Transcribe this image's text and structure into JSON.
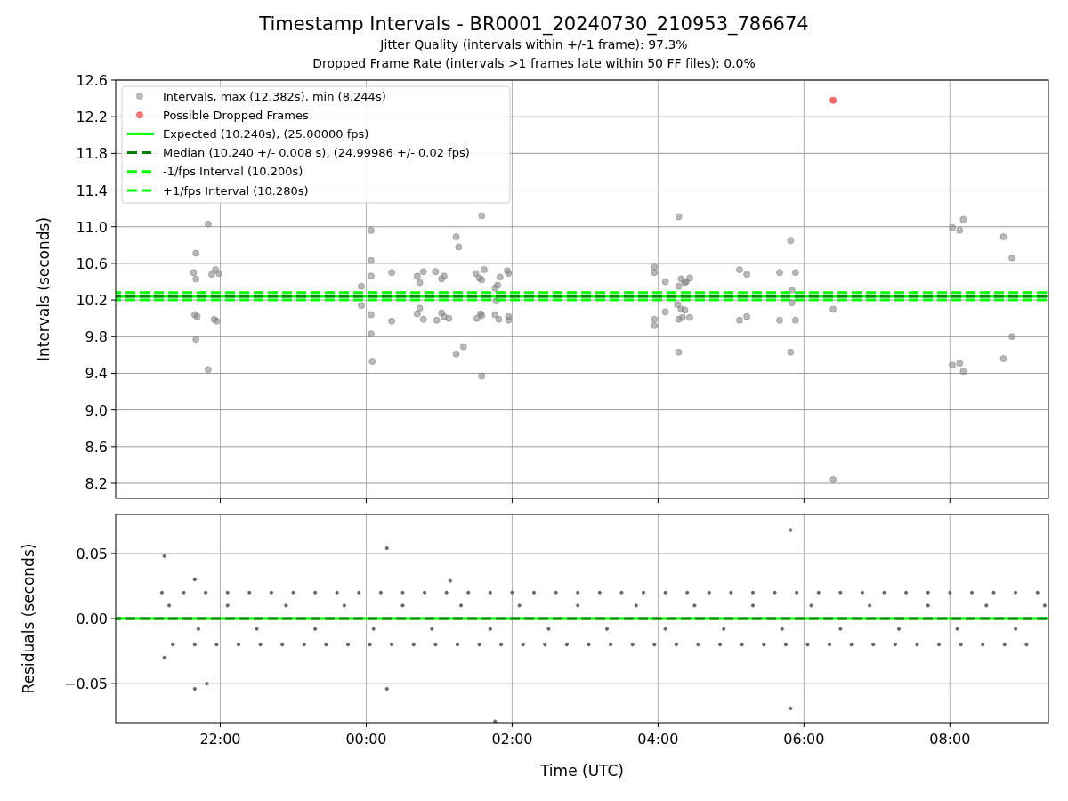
{
  "figure": {
    "title": "Timestamp Intervals - BR0001_20240730_210953_786674",
    "subtitles": [
      "Jitter Quality (intervals within +/-1 frame): 97.3%",
      "Dropped Frame Rate (intervals >1 frames late within 50 FF files): 0.0%"
    ]
  },
  "intervals_plot": {
    "chart_data": {
      "type": "scatter",
      "ylabel": "Intervals (seconds)",
      "xlim": [
        "2024-07-30T20:34",
        "2024-07-31T09:21"
      ],
      "ylim": [
        8.035,
        12.6
      ],
      "grid": true,
      "legend": true,
      "yticks": [
        {
          "value": 8.2,
          "label": "8.2"
        },
        {
          "value": 8.6,
          "label": "8.6"
        },
        {
          "value": 9.0,
          "label": "9.0"
        },
        {
          "value": 9.4,
          "label": "9.4"
        },
        {
          "value": 9.8,
          "label": "9.8"
        },
        {
          "value": 10.2,
          "label": "10.2"
        },
        {
          "value": 10.6,
          "label": "10.6"
        },
        {
          "value": 11.0,
          "label": "11.0"
        },
        {
          "value": 11.4,
          "label": "11.4"
        },
        {
          "value": 11.8,
          "label": "11.8"
        },
        {
          "value": 12.2,
          "label": "12.2"
        },
        {
          "value": 12.6,
          "label": "12.6"
        }
      ],
      "series": [
        {
          "name": "Intervals, max (12.382s), min (8.244s)",
          "color": "#808080",
          "x": [
            "2024-07-30T21:50",
            "2024-07-30T21:40",
            "2024-07-30T21:38",
            "2024-07-30T21:40",
            "2024-07-30T21:56",
            "2024-07-30T21:53",
            "2024-07-30T21:59",
            "2024-07-30T21:39",
            "2024-07-30T21:41",
            "2024-07-30T21:55",
            "2024-07-30T21:57",
            "2024-07-30T21:40",
            "2024-07-30T21:50",
            "2024-07-31T00:04",
            "2024-07-31T00:04",
            "2024-07-31T00:04",
            "2024-07-30T23:56",
            "2024-07-30T23:56",
            "2024-07-31T00:04",
            "2024-07-31T00:04",
            "2024-07-31T00:05",
            "2024-07-31T00:21",
            "2024-07-31T00:21",
            "2024-07-31T00:42",
            "2024-07-31T00:47",
            "2024-07-31T00:42",
            "2024-07-31T00:44",
            "2024-07-31T00:47",
            "2024-07-31T00:44",
            "2024-07-31T00:57",
            "2024-07-31T00:58",
            "2024-07-31T01:04",
            "2024-07-31T01:02",
            "2024-07-31T01:02",
            "2024-07-31T01:04",
            "2024-07-31T01:08",
            "2024-07-31T01:14",
            "2024-07-31T01:16",
            "2024-07-31T01:14",
            "2024-07-31T01:20",
            "2024-07-31T01:30",
            "2024-07-31T01:33",
            "2024-07-31T01:35",
            "2024-07-31T01:31",
            "2024-07-31T01:34",
            "2024-07-31T01:35",
            "2024-07-31T01:35",
            "2024-07-31T01:35",
            "2024-07-31T01:37",
            "2024-07-31T01:46",
            "2024-07-31T01:48",
            "2024-07-31T01:46",
            "2024-07-31T01:47",
            "2024-07-31T01:50",
            "2024-07-31T01:49",
            "2024-07-31T01:56",
            "2024-07-31T01:57",
            "2024-07-31T01:57",
            "2024-07-31T01:57",
            "2024-07-31T03:57",
            "2024-07-31T03:57",
            "2024-07-31T03:57",
            "2024-07-31T03:57",
            "2024-07-31T04:06",
            "2024-07-31T04:06",
            "2024-07-31T04:17",
            "2024-07-31T04:17",
            "2024-07-31T04:17",
            "2024-07-31T04:19",
            "2024-07-31T04:22",
            "2024-07-31T04:23",
            "2024-07-31T04:26",
            "2024-07-31T04:16",
            "2024-07-31T04:19",
            "2024-07-31T04:22",
            "2024-07-31T04:17",
            "2024-07-31T04:20",
            "2024-07-31T04:26",
            "2024-07-31T05:07",
            "2024-07-31T05:13",
            "2024-07-31T05:07",
            "2024-07-31T05:13",
            "2024-07-31T05:40",
            "2024-07-31T05:53",
            "2024-07-31T05:40",
            "2024-07-31T05:53",
            "2024-07-31T05:49",
            "2024-07-31T05:49",
            "2024-07-31T05:50",
            "2024-07-31T05:50",
            "2024-07-31T06:24",
            "2024-07-31T06:24",
            "2024-07-31T08:02",
            "2024-07-31T08:08",
            "2024-07-31T08:11",
            "2024-07-31T08:02",
            "2024-07-31T08:08",
            "2024-07-31T08:11",
            "2024-07-31T08:44",
            "2024-07-31T08:51",
            "2024-07-31T08:44",
            "2024-07-31T08:51"
          ],
          "values": [
            11.03,
            10.71,
            10.5,
            10.43,
            10.53,
            10.48,
            10.49,
            10.04,
            10.02,
            9.99,
            9.97,
            9.77,
            9.44,
            10.96,
            10.63,
            10.46,
            10.35,
            10.14,
            10.04,
            9.83,
            9.53,
            10.5,
            9.97,
            10.46,
            10.51,
            10.05,
            10.11,
            9.99,
            10.39,
            10.51,
            9.98,
            10.46,
            10.43,
            10.06,
            10.02,
            10.0,
            10.89,
            10.78,
            9.61,
            9.69,
            10.49,
            10.44,
            10.42,
            10.0,
            10.05,
            10.03,
            11.12,
            9.37,
            10.53,
            10.33,
            10.36,
            10.04,
            10.19,
            10.45,
            9.99,
            10.52,
            10.49,
            9.98,
            10.02,
            10.56,
            10.5,
            9.99,
            9.92,
            10.07,
            10.4,
            11.11,
            9.63,
            10.35,
            10.43,
            10.39,
            10.4,
            10.44,
            10.15,
            10.1,
            10.09,
            9.99,
            10.01,
            10.01,
            10.53,
            10.48,
            9.98,
            10.02,
            10.5,
            10.5,
            9.98,
            9.98,
            10.85,
            9.63,
            10.31,
            10.17,
            10.1,
            8.24,
            10.99,
            10.96,
            11.08,
            9.49,
            9.51,
            9.42,
            10.89,
            10.66,
            9.56,
            9.8
          ]
        },
        {
          "name": "Possible Dropped Frames",
          "color": "#ff0000",
          "x": [
            "2024-07-31T06:24"
          ],
          "values": [
            12.38
          ]
        }
      ],
      "ref_lines": [
        {
          "axis": "y",
          "value": 10.24,
          "label": "Expected (10.240s), (25.00000 fps)",
          "color": "#00ff00"
        },
        {
          "axis": "y",
          "value": 10.24,
          "label": "Median (10.240 +/- 0.008 s), (24.99986 +/- 0.02 fps)",
          "color": "#008000"
        },
        {
          "axis": "y",
          "value": 10.2,
          "label": "-1/fps Interval (10.200s)",
          "color": "#00ff00"
        },
        {
          "axis": "y",
          "value": 10.28,
          "label": "+1/fps Interval (10.280s)",
          "color": "#00ff00"
        }
      ]
    }
  },
  "residuals_plot": {
    "chart_data": {
      "type": "scatter",
      "xlabel": "Time (UTC)",
      "ylabel": "Residuals (seconds)",
      "xlim": [
        "2024-07-30T20:34",
        "2024-07-31T09:21"
      ],
      "ylim": [
        -0.08,
        0.08
      ],
      "grid": true,
      "xticks": [
        {
          "value": "2024-07-30T22:00",
          "label": "22:00"
        },
        {
          "value": "2024-07-31T00:00",
          "label": "00:00"
        },
        {
          "value": "2024-07-31T02:00",
          "label": "02:00"
        },
        {
          "value": "2024-07-31T04:00",
          "label": "04:00"
        },
        {
          "value": "2024-07-31T06:00",
          "label": "06:00"
        },
        {
          "value": "2024-07-31T08:00",
          "label": "08:00"
        }
      ],
      "yticks": [
        {
          "value": -0.05,
          "label": "−0.05"
        },
        {
          "value": 0,
          "label": "0.00"
        },
        {
          "value": 0.05,
          "label": "0.05"
        }
      ],
      "series": [
        {
          "color": "#666666",
          "x": [
            "2024-07-30T21:14",
            "2024-07-30T21:14",
            "2024-07-30T21:39",
            "2024-07-30T21:49",
            "2024-07-31T00:17",
            "2024-07-31T00:17",
            "2024-07-31T01:46",
            "2024-07-31T05:49",
            "2024-07-31T05:49",
            "2024-07-30T21:39",
            "2024-07-31T01:09",
            "2024-07-30T21:12",
            "2024-07-30T21:21",
            "2024-07-30T21:30",
            "2024-07-30T21:39",
            "2024-07-30T21:48",
            "2024-07-30T21:57",
            "2024-07-30T22:06",
            "2024-07-30T22:15",
            "2024-07-30T22:24",
            "2024-07-30T22:33",
            "2024-07-30T22:42",
            "2024-07-30T22:51",
            "2024-07-30T23:00",
            "2024-07-30T23:09",
            "2024-07-30T23:18",
            "2024-07-30T23:27",
            "2024-07-30T23:36",
            "2024-07-30T23:45",
            "2024-07-30T23:54",
            "2024-07-31T00:03",
            "2024-07-31T00:12",
            "2024-07-31T00:21",
            "2024-07-31T00:30",
            "2024-07-31T00:39",
            "2024-07-31T00:48",
            "2024-07-31T00:57",
            "2024-07-31T01:06",
            "2024-07-31T01:15",
            "2024-07-31T01:24",
            "2024-07-31T01:33",
            "2024-07-31T01:42",
            "2024-07-31T01:51",
            "2024-07-31T02:00",
            "2024-07-31T02:09",
            "2024-07-31T02:18",
            "2024-07-31T02:27",
            "2024-07-31T02:36",
            "2024-07-31T02:45",
            "2024-07-31T02:54",
            "2024-07-31T03:03",
            "2024-07-31T03:12",
            "2024-07-31T03:21",
            "2024-07-31T03:30",
            "2024-07-31T03:39",
            "2024-07-31T03:48",
            "2024-07-31T03:57",
            "2024-07-31T04:06",
            "2024-07-31T04:15",
            "2024-07-31T04:24",
            "2024-07-31T04:33",
            "2024-07-31T04:42",
            "2024-07-31T04:51",
            "2024-07-31T05:00",
            "2024-07-31T05:09",
            "2024-07-31T05:18",
            "2024-07-31T05:27",
            "2024-07-31T05:36",
            "2024-07-31T05:45",
            "2024-07-31T05:54",
            "2024-07-31T06:03",
            "2024-07-31T06:12",
            "2024-07-31T06:21",
            "2024-07-31T06:30",
            "2024-07-31T06:39",
            "2024-07-31T06:48",
            "2024-07-31T06:57",
            "2024-07-31T07:06",
            "2024-07-31T07:15",
            "2024-07-31T07:24",
            "2024-07-31T07:33",
            "2024-07-31T07:42",
            "2024-07-31T07:51",
            "2024-07-31T08:00",
            "2024-07-31T08:09",
            "2024-07-31T08:18",
            "2024-07-31T08:27",
            "2024-07-31T08:36",
            "2024-07-31T08:45",
            "2024-07-31T08:54",
            "2024-07-31T09:03",
            "2024-07-31T09:12",
            "2024-07-30T21:18",
            "2024-07-30T21:42",
            "2024-07-30T22:06",
            "2024-07-30T22:30",
            "2024-07-30T22:54",
            "2024-07-30T23:18",
            "2024-07-30T23:42",
            "2024-07-31T00:06",
            "2024-07-31T00:30",
            "2024-07-31T00:54",
            "2024-07-31T01:18",
            "2024-07-31T01:42",
            "2024-07-31T02:06",
            "2024-07-31T02:30",
            "2024-07-31T02:54",
            "2024-07-31T03:18",
            "2024-07-31T03:42",
            "2024-07-31T04:06",
            "2024-07-31T04:30",
            "2024-07-31T04:54",
            "2024-07-31T05:18",
            "2024-07-31T05:42",
            "2024-07-31T06:06",
            "2024-07-31T06:30",
            "2024-07-31T06:54",
            "2024-07-31T07:18",
            "2024-07-31T07:42",
            "2024-07-31T08:06",
            "2024-07-31T08:30",
            "2024-07-31T08:54",
            "2024-07-31T09:18"
          ],
          "values": [
            0.048,
            -0.03,
            -0.054,
            -0.05,
            0.054,
            -0.054,
            -0.079,
            0.068,
            -0.069,
            0.03,
            0.029,
            0.02,
            -0.02,
            0.02,
            -0.02,
            0.02,
            -0.02,
            0.02,
            -0.02,
            0.02,
            -0.02,
            0.02,
            -0.02,
            0.02,
            -0.02,
            0.02,
            -0.02,
            0.02,
            -0.02,
            0.02,
            -0.02,
            0.02,
            -0.02,
            0.02,
            -0.02,
            0.02,
            -0.02,
            0.02,
            -0.02,
            0.02,
            -0.02,
            0.02,
            -0.02,
            0.02,
            -0.02,
            0.02,
            -0.02,
            0.02,
            -0.02,
            0.02,
            -0.02,
            0.02,
            -0.02,
            0.02,
            -0.02,
            0.02,
            -0.02,
            0.02,
            -0.02,
            0.02,
            -0.02,
            0.02,
            -0.02,
            0.02,
            -0.02,
            0.02,
            -0.02,
            0.02,
            -0.02,
            0.02,
            -0.02,
            0.02,
            -0.02,
            0.02,
            -0.02,
            0.02,
            -0.02,
            0.02,
            -0.02,
            0.02,
            -0.02,
            0.02,
            -0.02,
            0.02,
            -0.02,
            0.02,
            -0.02,
            0.02,
            -0.02,
            0.02,
            -0.02,
            0.02,
            0.01,
            -0.008,
            0.01,
            -0.008,
            0.01,
            -0.008,
            0.01,
            -0.008,
            0.01,
            -0.008,
            0.01,
            -0.008,
            0.01,
            -0.008,
            0.01,
            -0.008,
            0.01,
            -0.008,
            0.01,
            -0.008,
            0.01,
            -0.008,
            0.01,
            -0.008,
            0.01,
            -0.008,
            0.01,
            -0.008,
            0.01,
            -0.008,
            0.01
          ]
        }
      ],
      "ref_lines": [
        {
          "axis": "y",
          "value": 0,
          "color": "#00ff00"
        },
        {
          "axis": "y",
          "value": 0,
          "color": "#008000"
        }
      ]
    }
  }
}
